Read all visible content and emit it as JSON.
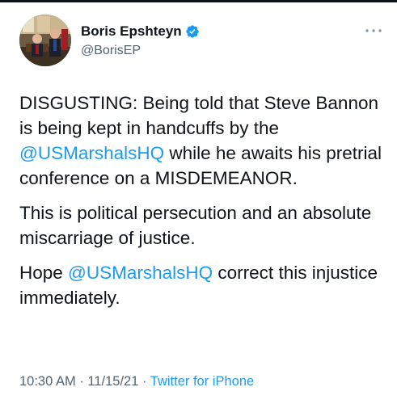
{
  "user": {
    "display_name": "Boris Epshteyn",
    "handle": "@BorisEP",
    "verified_icon": "verified-badge-icon",
    "avatar_icon": "profile-photo"
  },
  "menu": {
    "more_icon": "more-horizontal-icon"
  },
  "tweet": {
    "p1_a": "DISGUSTING: Being told that Steve Bannon is being kept in handcuffs by the ",
    "p1_mention": "@USMarshalsHQ",
    "p1_b": " while he awaits his pretrial conference on a MISDEMEANOR.",
    "p2": "This is political persecution and an absolute miscarriage of justice.",
    "p3_a": "Hope ",
    "p3_mention": "@USMarshalsHQ",
    "p3_b": " correct this injustice immediately."
  },
  "meta": {
    "time": "10:30 AM",
    "sep1": " · ",
    "date": "11/15/21",
    "sep2": " · ",
    "source": "Twitter for iPhone"
  },
  "colors": {
    "link": "#1d9bf0",
    "text": "#0f1419",
    "secondary": "#536471"
  }
}
